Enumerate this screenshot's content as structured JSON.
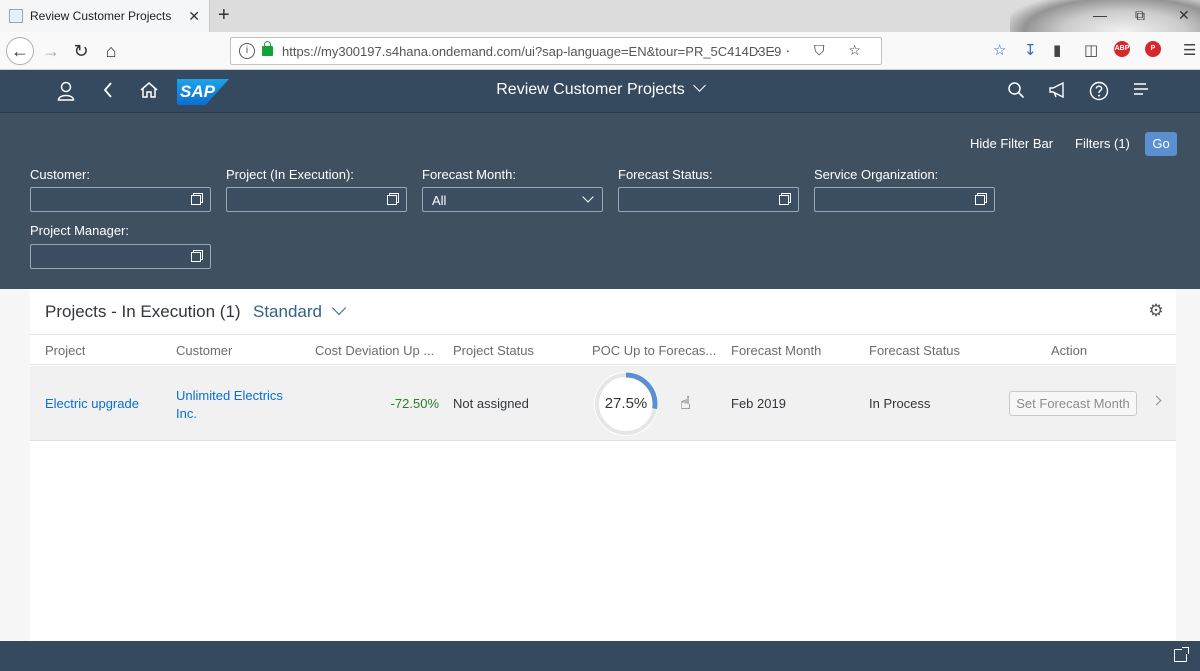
{
  "browser": {
    "tab_title": "Review Customer Projects",
    "tab_close": "✕",
    "new_tab": "+",
    "url": "https://my300197.s4hana.ondemand.com/ui?sap-language=EN&tour=PR_5C414D3E9",
    "url_tools": "··· ⛉ ☆",
    "minimize": "—",
    "restore": "⧉",
    "close": "✕",
    "abp": "ABP"
  },
  "shell": {
    "logo": "SAP",
    "title": "Review Customer Projects"
  },
  "filterbar": {
    "hide_filter_bar": "Hide Filter Bar",
    "filters": "Filters (1)",
    "go": "Go",
    "fields": {
      "customer": "Customer:",
      "project": "Project (In Execution):",
      "forecast_month": "Forecast Month:",
      "forecast_month_value": "All",
      "forecast_status": "Forecast Status:",
      "service_org": "Service Organization:",
      "project_manager": "Project Manager:"
    }
  },
  "table": {
    "title": "Projects - In Execution (1)",
    "variant": "Standard",
    "columns": {
      "project": "Project",
      "customer": "Customer",
      "cost_deviation": "Cost Deviation Up ...",
      "project_status": "Project Status",
      "poc": "POC Up to Forecas...",
      "forecast_month": "Forecast Month",
      "forecast_status": "Forecast Status",
      "action": "Action"
    },
    "rows": [
      {
        "project": "Electric upgrade",
        "customer_line1": "Unlimited Electrics",
        "customer_line2": "Inc.",
        "cost_deviation": "-72.50%",
        "project_status": "Not assigned",
        "poc": "27.5%",
        "poc_fraction": 0.275,
        "forecast_month": "Feb 2019",
        "forecast_status": "In Process",
        "action": "Set Forecast Month"
      }
    ]
  },
  "colors": {
    "shell": "#354a5f",
    "filterbar": "#3f5161",
    "link": "#0a6ed1",
    "positive": "#2b7d2b",
    "donut_fill": "#5a8fd0"
  }
}
